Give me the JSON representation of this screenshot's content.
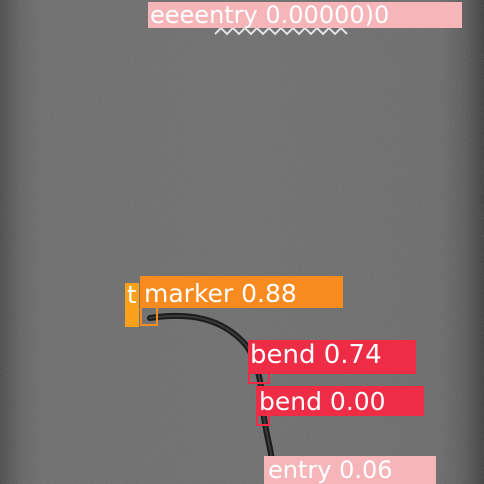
{
  "detections": [
    {
      "id": "entry-top",
      "label": "eeeentry 0.00000)0",
      "color": "#f6b5b8"
    },
    {
      "id": "marker",
      "label": "marker 0.88",
      "color": "#f78b1f"
    },
    {
      "id": "marker-tail",
      "label": "t",
      "color": "#f9a11b"
    },
    {
      "id": "bend-a",
      "label": "bend 0.74",
      "color": "#ee2c45"
    },
    {
      "id": "bend-b",
      "label": "bend 0.00",
      "color": "#ee2c45"
    },
    {
      "id": "entry-bottom",
      "label": "entry 0.06",
      "color": "#f6b5b8"
    }
  ],
  "scene": {
    "background": "#6a6a6a",
    "wire_color": "#1c1c1c"
  }
}
